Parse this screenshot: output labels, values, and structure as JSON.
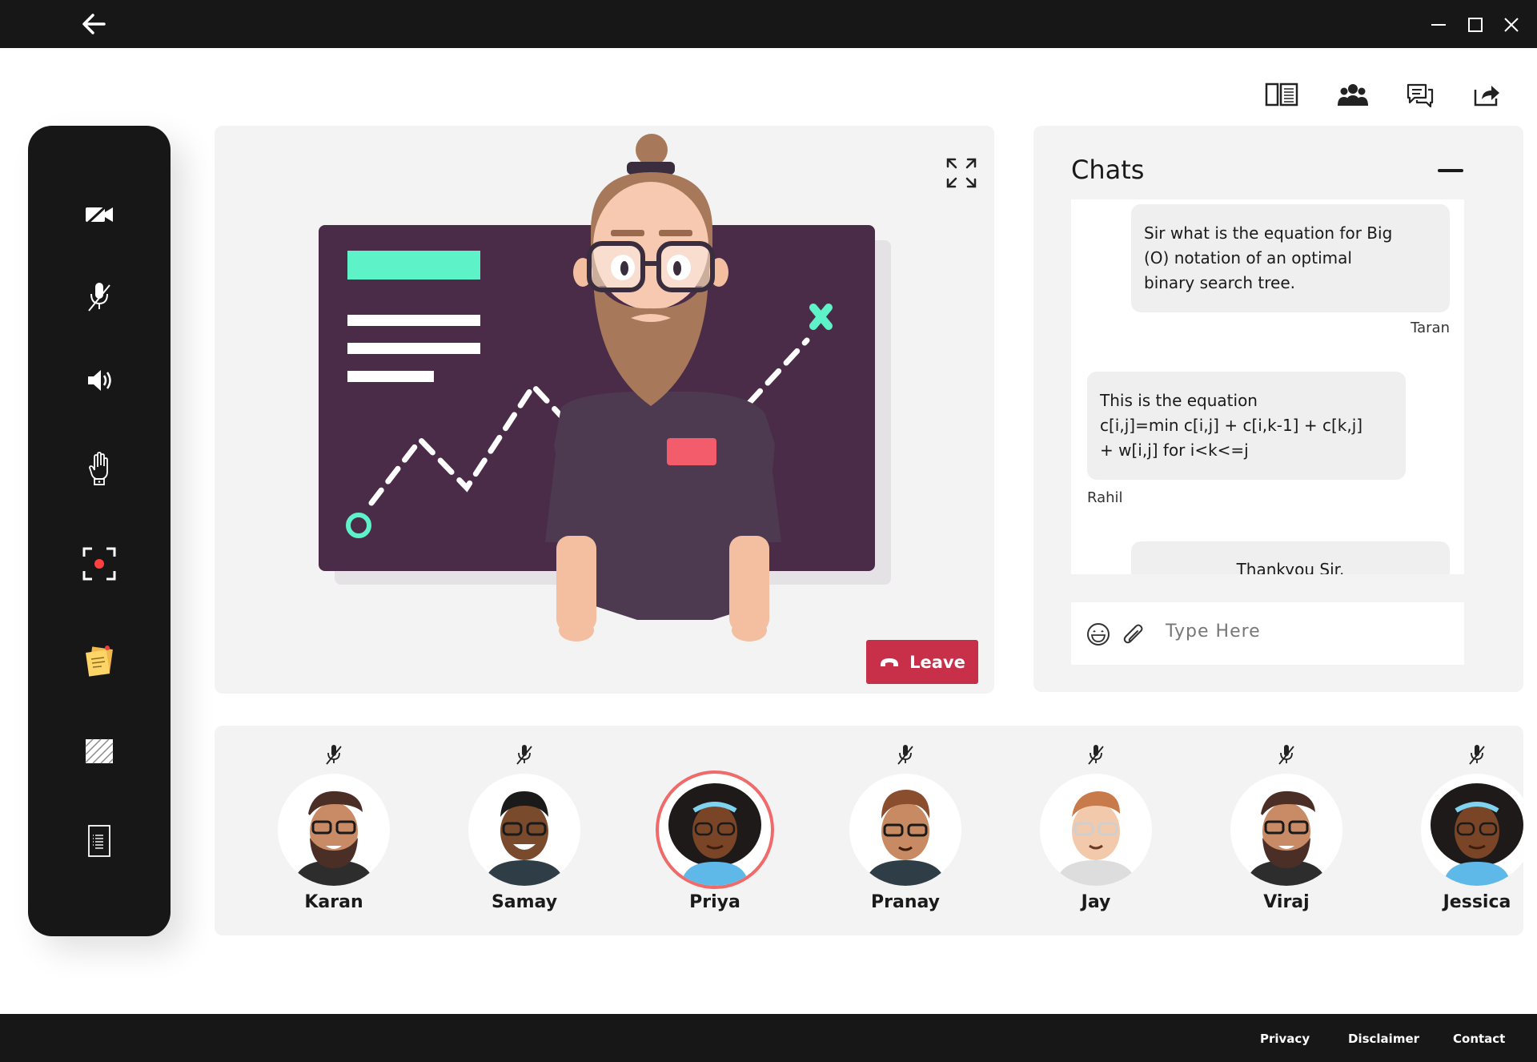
{
  "colors": {
    "titlebar": "#171717",
    "panel": "#f3f3f3",
    "leave": "#c8304a",
    "active_ring": "#f06a6a",
    "board": "#4a2c49",
    "accent": "#5ef2c8"
  },
  "toolbar": {
    "icons": [
      "layout-toggle-icon",
      "participants-icon",
      "chat-icon",
      "share-icon"
    ]
  },
  "rail": {
    "buttons": [
      "camera-off-icon",
      "mic-off-icon",
      "speaker-icon",
      "raise-hand-icon",
      "screen-record-icon",
      "sticky-notes-icon",
      "whiteboard-icon",
      "document-icon"
    ]
  },
  "video": {
    "leave_label": "Leave"
  },
  "chat": {
    "title": "Chats",
    "messages": [
      {
        "text_lines": [
          "Sir what is the equation for Big",
          "(O) notation of an optimal",
          "binary search tree."
        ],
        "sender": "Taran"
      },
      {
        "text_lines": [
          "This is the equation",
          "c[i,j]=min c[i,j] + c[i,k-1] + c[k,j]",
          "+ w[i,j] for i<k<=j"
        ],
        "sender": "Rahil"
      },
      {
        "text_lines": [
          "Thankyou Sir."
        ],
        "sender": ""
      }
    ],
    "composer_placeholder": "Type Here"
  },
  "participants": [
    {
      "name": "Karan",
      "muted": true,
      "active": false
    },
    {
      "name": "Samay",
      "muted": true,
      "active": false
    },
    {
      "name": "Priya",
      "muted": false,
      "active": true
    },
    {
      "name": "Pranay",
      "muted": true,
      "active": false
    },
    {
      "name": "Jay",
      "muted": true,
      "active": false
    },
    {
      "name": "Viraj",
      "muted": true,
      "active": false
    },
    {
      "name": "Jessica",
      "muted": true,
      "active": false
    }
  ],
  "footer": {
    "links": [
      "Privacy",
      "Disclaimer",
      "Contact"
    ]
  }
}
